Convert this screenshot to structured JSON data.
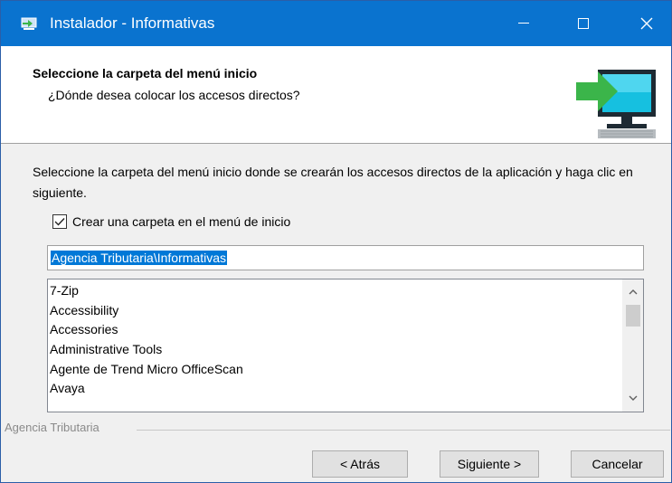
{
  "window": {
    "title": "Instalador - Informativas",
    "controls": {
      "minimize": "minimize-icon",
      "maximize": "maximize-icon",
      "close": "close-icon"
    }
  },
  "header": {
    "title": "Seleccione la carpeta del menú inicio",
    "subtitle": "¿Dónde desea colocar los accesos directos?",
    "icon": "monitor-arrow-icon"
  },
  "body": {
    "instructions": "Seleccione la carpeta del menú inicio donde se crearán los accesos directos de la aplicación y haga clic en siguiente.",
    "create_folder_checkbox": {
      "label": "Crear una carpeta en el menú de inicio",
      "checked": true
    },
    "folder_input": {
      "value": "Agencia Tributaria\\Informativas",
      "selected": true
    },
    "folder_list": [
      "7-Zip",
      "Accessibility",
      "Accessories",
      "Administrative Tools",
      "Agente de Trend Micro OfficeScan",
      "Avaya"
    ]
  },
  "footer": {
    "brand": "Agencia Tributaria",
    "back_label": "< Atrás",
    "next_label": "Siguiente >",
    "cancel_label": "Cancelar"
  },
  "colors": {
    "titlebar": "#0a73cf",
    "selection": "#0078d7",
    "dialog_bg": "#f0f0f0",
    "icon_green": "#3bb54a"
  }
}
